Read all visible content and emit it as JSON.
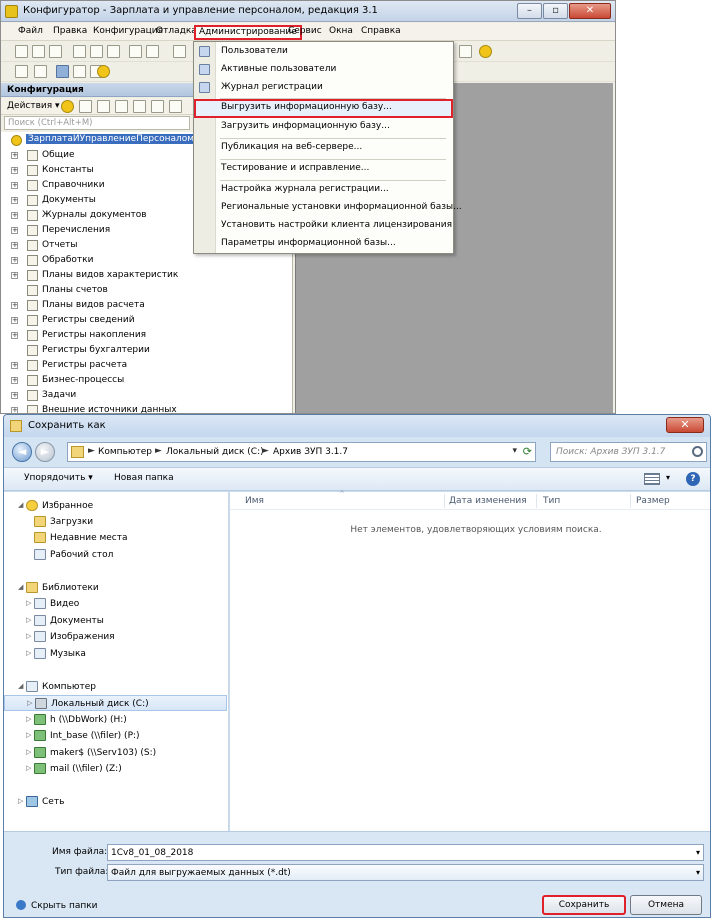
{
  "configurator": {
    "title": "Конфигуратор - Зарплата и управление персоналом, редакция 3.1",
    "window_buttons": [
      "–",
      "▫",
      "✕"
    ],
    "menu": [
      "Файл",
      "Правка",
      "Конфигурация",
      "Отладка",
      "Администрирование",
      "Сервис",
      "Окна",
      "Справка"
    ],
    "panel_title": "Конфигурация",
    "actions_label": "Действия ▾",
    "search_placeholder": "Поиск (Ctrl+Alt+M)",
    "tree_root": "ЗарплатаИУправлениеПерсоналом",
    "tree_items": [
      "Общие",
      "Константы",
      "Справочники",
      "Документы",
      "Журналы документов",
      "Перечисления",
      "Отчеты",
      "Обработки",
      "Планы видов характеристик",
      "Планы счетов",
      "Планы видов расчета",
      "Регистры сведений",
      "Регистры накопления",
      "Регистры бухгалтерии",
      "Регистры расчета",
      "Бизнес-процессы",
      "Задачи",
      "Внешние источники данных"
    ]
  },
  "admin_menu": {
    "items": [
      "Пользователи",
      "Активные пользователи",
      "Журнал регистрации",
      "Выгрузить информационную базу...",
      "Загрузить информационную базу...",
      "Публикация на веб-сервере...",
      "Тестирование и исправление...",
      "Настройка журнала регистрации...",
      "Региональные установки информационной базы...",
      "Установить настройки клиента лицензирования",
      "Параметры информационной базы..."
    ]
  },
  "dialog": {
    "title": "Сохранить как",
    "close": "✕",
    "back": "◄",
    "forward": "►",
    "breadcrumb": [
      "Компьютер",
      "Локальный диск (C:)",
      "Архив ЗУП 3.1.7"
    ],
    "crumb_sep": "►",
    "search_placeholder": "Поиск: Архив ЗУП 3.1.7",
    "organize": "Упорядочить ▾",
    "new_folder": "Новая папка",
    "help": "?",
    "favorites": "Избранное",
    "favorites_items": [
      "Загрузки",
      "Недавние места",
      "Рабочий стол"
    ],
    "libraries": "Библиотеки",
    "libraries_items": [
      "Видео",
      "Документы",
      "Изображения",
      "Музыка"
    ],
    "computer": "Компьютер",
    "computer_items": [
      "Локальный диск (C:)",
      "h (\\\\DbWork) (H:)",
      "Int_base (\\\\filer) (P:)",
      "maker$ (\\\\Serv103) (S:)",
      "mail (\\\\filer) (Z:)"
    ],
    "network": "Сеть",
    "columns": [
      "Имя",
      "Дата изменения",
      "Тип",
      "Размер"
    ],
    "empty_text": "Нет элементов, удовлетворяющих условиям поиска.",
    "filename_label": "Имя файла:",
    "filename_value": "1Cv8_01_08_2018",
    "filetype_label": "Тип файла:",
    "filetype_value": "Файл для выгружаемых данных (*.dt)",
    "hide_folders": "Скрыть папки",
    "save_button": "Сохранить",
    "cancel_button": "Отмена"
  },
  "colors": {
    "highlight_red": "#e0202a",
    "selection_blue": "#3a6dbd",
    "dialog_bg": "#d9e6f4"
  }
}
